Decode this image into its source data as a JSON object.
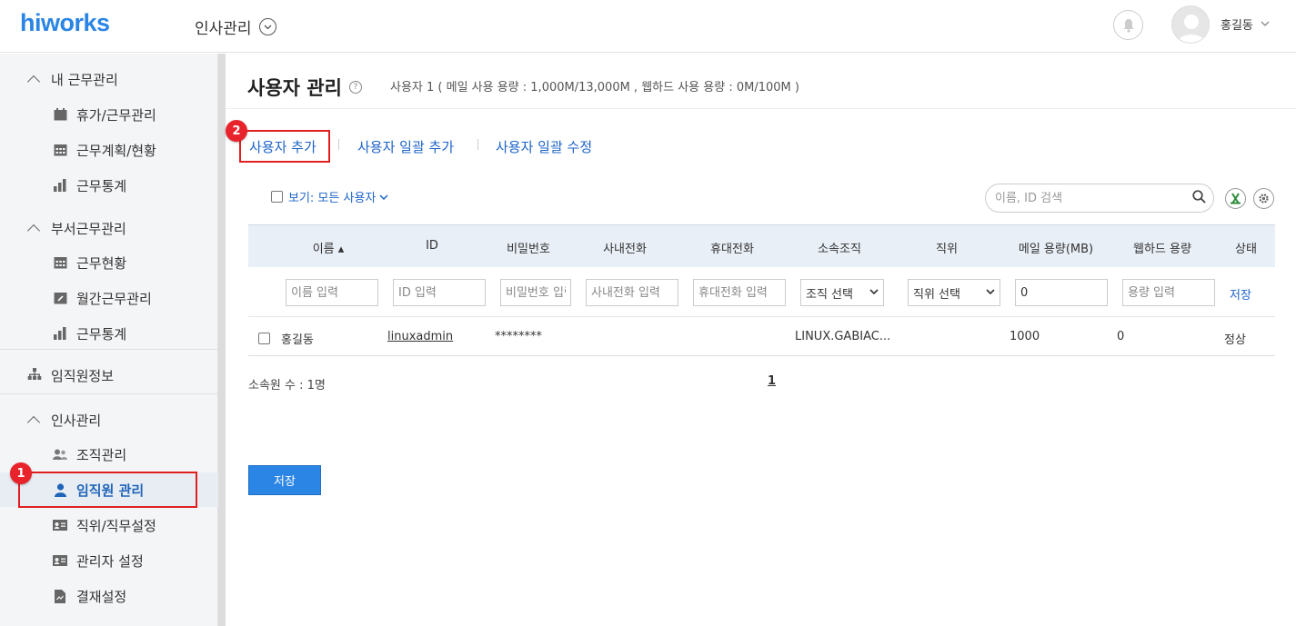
{
  "header": {
    "logo": "hiworks",
    "module_title": "인사관리",
    "username": "홍길동"
  },
  "sidebar": {
    "sections": [
      {
        "label": "내 근무관리",
        "items": [
          "휴가/근무관리",
          "근무계획/현황",
          "근무통계"
        ]
      },
      {
        "label": "부서근무관리",
        "items": [
          "근무현황",
          "월간근무관리",
          "근무통계"
        ]
      },
      {
        "label": "임직원정보",
        "items": []
      },
      {
        "label": "인사관리",
        "items": [
          "조직관리",
          "임직원 관리",
          "직위/직무설정",
          "관리자 설정",
          "결재설정"
        ]
      }
    ],
    "active_item": "임직원 관리"
  },
  "annotations": {
    "badge1": "1",
    "badge2": "2"
  },
  "main": {
    "title": "사용자 관리",
    "help": "?",
    "usage": "사용자 1 ( 메일 사용 용량 : 1,000M/13,000M , 웹하드 사용 용량 : 0M/100M )",
    "actions": [
      "사용자 추가",
      "사용자 일괄 추가",
      "사용자 일괄 수정"
    ],
    "view_filter": "보기: 모든 사용자",
    "search_placeholder": "이름, ID 검색",
    "columns": [
      "이름 ▴",
      "ID",
      "비밀번호",
      "사내전화",
      "휴대전화",
      "소속조직",
      "직위",
      "메일 용량(MB)",
      "웹하드 용량",
      "상태"
    ],
    "filter_row": {
      "name_ph": "이름 입력",
      "id_ph": "ID 입력",
      "pw_ph": "비밀번호 입력",
      "office_ph": "사내전화 입력",
      "mobile_ph": "휴대전화 입력",
      "org_select": "조직 선택",
      "position_select": "직위 선택",
      "mail_value": "0",
      "webhard_ph": "용량 입력",
      "save": "저장"
    },
    "rows": [
      {
        "name": "홍길동",
        "id": "linuxadmin",
        "password": "********",
        "org": "LINUX.GABIAC...",
        "mail": "1000",
        "webhard": "0",
        "status": "정상"
      }
    ],
    "member_count": "소속원 수 : 1명",
    "page": "1",
    "save_button": "저장"
  },
  "colors": {
    "brand": "#2b85e4",
    "link": "#1e64c8",
    "annotation_red": "#e02020"
  }
}
